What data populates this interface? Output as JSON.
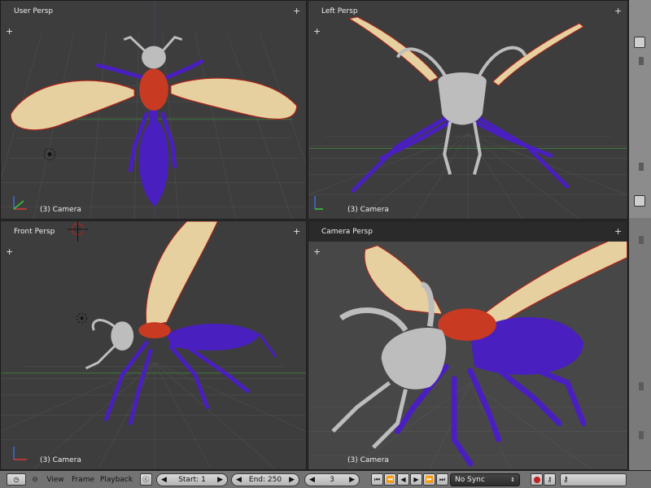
{
  "viewports": {
    "top_left": {
      "label": "User Persp",
      "camera": "(3) Camera"
    },
    "top_right": {
      "label": "Left Persp",
      "camera": "(3) Camera"
    },
    "bottom_left": {
      "label": "Front Persp",
      "camera": "(3) Camera"
    },
    "bottom_right": {
      "label": "Camera Persp",
      "camera": "(3) Camera"
    }
  },
  "timeline": {
    "menus": [
      "View",
      "Frame",
      "Playback"
    ],
    "start": "Start: 1",
    "end": "End: 250",
    "current_frame": "3",
    "sync": "No Sync"
  },
  "colors": {
    "wing": "#e6d0a0",
    "wing_edge": "#b02018",
    "body": "#4a1fc0",
    "thorax": "#c83a22",
    "head": "#bdbdbd",
    "grid": "#4e4e4e",
    "background": "#3d3d3d"
  },
  "icons": {
    "plus": "plus-icon",
    "axes": "axes-gizmo-icon",
    "lamp": "lamp-icon",
    "camera_target": "crosshair-icon"
  }
}
